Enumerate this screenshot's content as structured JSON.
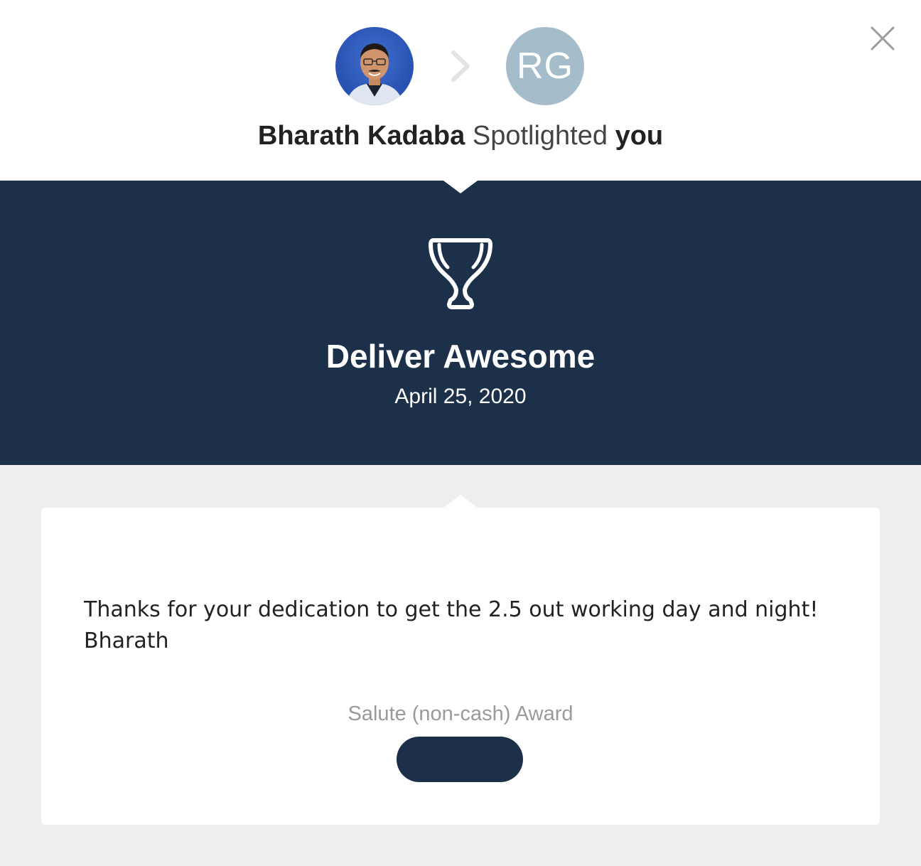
{
  "header": {
    "sender_name": "Bharath Kadaba",
    "action_text": "Spotlighted",
    "recipient_text": "you",
    "sender_avatar": {
      "icon": "person-photo"
    },
    "recipient_avatar": {
      "initials": "RG",
      "color": "#a5bccb"
    },
    "arrow_icon": "chevron-right-icon",
    "close_icon": "close-icon"
  },
  "award": {
    "icon": "trophy-icon",
    "title": "Deliver Awesome",
    "date": "April 25, 2020",
    "band_color": "#1d3049"
  },
  "message": {
    "lines": [
      "Thanks for your dedication to get the 2.5 out working day and night!",
      "Bharath"
    ]
  },
  "award_type": "Salute (non-cash) Award",
  "action_button": {
    "label": "",
    "color": "#1d3049"
  }
}
